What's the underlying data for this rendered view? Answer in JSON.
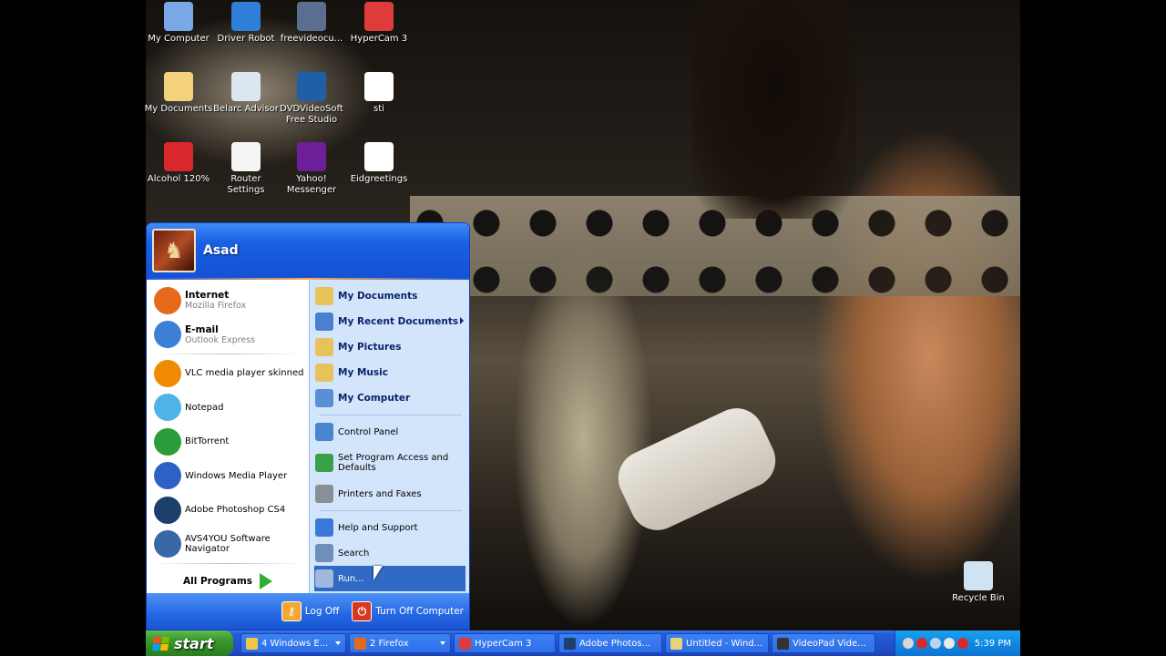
{
  "desktop": {
    "icons": [
      {
        "label": "My Computer",
        "icon": "my-computer-icon",
        "color": "#7aa8e6"
      },
      {
        "label": "Driver Robot",
        "icon": "driver-robot-icon",
        "color": "#2f7ed8"
      },
      {
        "label": "freevideocu...",
        "icon": "freevideo-icon",
        "color": "#5a6f90"
      },
      {
        "label": "HyperCam 3",
        "icon": "hypercam-icon",
        "color": "#e03b3b"
      },
      {
        "label": "My Documents",
        "icon": "my-documents-icon",
        "color": "#f3d27a"
      },
      {
        "label": "Belarc Advisor",
        "icon": "belarc-advisor-icon",
        "color": "#dce6f0"
      },
      {
        "label": "DVDVideoSoft Free Studio",
        "icon": "dvdvideosoft-icon",
        "color": "#1f5fa8"
      },
      {
        "label": "sti",
        "icon": "document-icon",
        "color": "#ffffff"
      },
      {
        "label": "Alcohol 120%",
        "icon": "alcohol-icon",
        "color": "#d8282c"
      },
      {
        "label": "Router Settings",
        "icon": "text-file-icon",
        "color": "#f5f5f5"
      },
      {
        "label": "Yahoo! Messenger",
        "icon": "yahoo-messenger-icon",
        "color": "#6d1f9a"
      },
      {
        "label": "Eidgreetings",
        "icon": "document-icon",
        "color": "#ffffff"
      },
      {
        "label": "Recycle Bin",
        "icon": "recycle-bin-icon",
        "color": "#cfe3f3"
      }
    ]
  },
  "start_menu": {
    "user": "Asad",
    "left_items": [
      {
        "title": "Internet",
        "subtitle": "Mozilla Firefox",
        "icon": "firefox-icon",
        "color": "#e66a1c"
      },
      {
        "title": "E-mail",
        "subtitle": "Outlook Express",
        "icon": "outlook-express-icon",
        "color": "#3c7fd6"
      },
      {
        "title": "VLC media player skinned",
        "icon": "vlc-icon",
        "color": "#f08a00"
      },
      {
        "title": "Notepad",
        "icon": "notepad-icon",
        "color": "#4fb3e8"
      },
      {
        "title": "BitTorrent",
        "icon": "bittorrent-icon",
        "color": "#2a9c3a"
      },
      {
        "title": "Windows Media Player",
        "icon": "windows-media-player-icon",
        "color": "#2f61c4"
      },
      {
        "title": "Adobe Photoshop CS4",
        "icon": "photoshop-icon",
        "color": "#1c3f6b"
      },
      {
        "title": "AVS4YOU Software Navigator",
        "icon": "avs4you-icon",
        "color": "#3b66a8"
      }
    ],
    "all_programs": "All Programs",
    "right_items": [
      {
        "label": "My Documents",
        "icon": "folder-icon",
        "color": "#e7c25a",
        "style": "bold"
      },
      {
        "label": "My Recent Documents",
        "icon": "recent-documents-icon",
        "color": "#4b7fcf",
        "style": "bold",
        "submenu": true
      },
      {
        "label": "My Pictures",
        "icon": "pictures-folder-icon",
        "color": "#e7c25a",
        "style": "bold"
      },
      {
        "label": "My Music",
        "icon": "music-folder-icon",
        "color": "#e7c25a",
        "style": "bold"
      },
      {
        "label": "My Computer",
        "icon": "my-computer-icon",
        "color": "#5a8fd6",
        "style": "bold"
      },
      {
        "label": "Control Panel",
        "icon": "control-panel-icon",
        "color": "#4a86d0",
        "style": "norm",
        "sep_before": true
      },
      {
        "label": "Set Program Access and Defaults",
        "icon": "program-access-icon",
        "color": "#3aa048",
        "style": "norm",
        "two": true
      },
      {
        "label": "Printers and Faxes",
        "icon": "printer-icon",
        "color": "#8a8f96",
        "style": "norm"
      },
      {
        "label": "Help and Support",
        "icon": "help-icon",
        "color": "#3b78d8",
        "style": "norm",
        "sep_before": true
      },
      {
        "label": "Search",
        "icon": "search-icon",
        "color": "#6f8fb8",
        "style": "norm"
      },
      {
        "label": "Run...",
        "icon": "run-icon",
        "color": "#9fb8dc",
        "style": "norm",
        "hover": true
      }
    ],
    "log_off": "Log Off",
    "turn_off": "Turn Off Computer"
  },
  "taskbar": {
    "start_label": "start",
    "tasks": [
      {
        "label": "4 Windows E...",
        "icon": "folder-icon",
        "color": "#f0c64a",
        "dropdown": true,
        "width": 116
      },
      {
        "label": "2 Firefox",
        "icon": "firefox-icon",
        "color": "#e66a1c",
        "dropdown": true,
        "width": 112
      },
      {
        "label": "HyperCam 3",
        "icon": "hypercam-icon",
        "color": "#e03b3b",
        "width": 112
      },
      {
        "label": "Adobe Photos...",
        "icon": "photoshop-icon",
        "color": "#1c3f6b",
        "width": 114
      },
      {
        "label": "Untitled - Wind...",
        "icon": "paint-icon",
        "color": "#e9d07a",
        "width": 114
      },
      {
        "label": "VideoPad Vide...",
        "icon": "videopad-icon",
        "color": "#333333",
        "width": 114
      }
    ],
    "tray_icons": [
      {
        "icon": "messenger-tray-icon",
        "color": "#d7d7d7"
      },
      {
        "icon": "antivirus-tray-icon",
        "color": "#d8282c"
      },
      {
        "icon": "network-tray-icon",
        "color": "#bcd4ee"
      },
      {
        "icon": "volume-tray-icon",
        "color": "#eaeaea"
      },
      {
        "icon": "alcohol-tray-icon",
        "color": "#d8282c"
      }
    ],
    "clock": "5:39 PM"
  }
}
